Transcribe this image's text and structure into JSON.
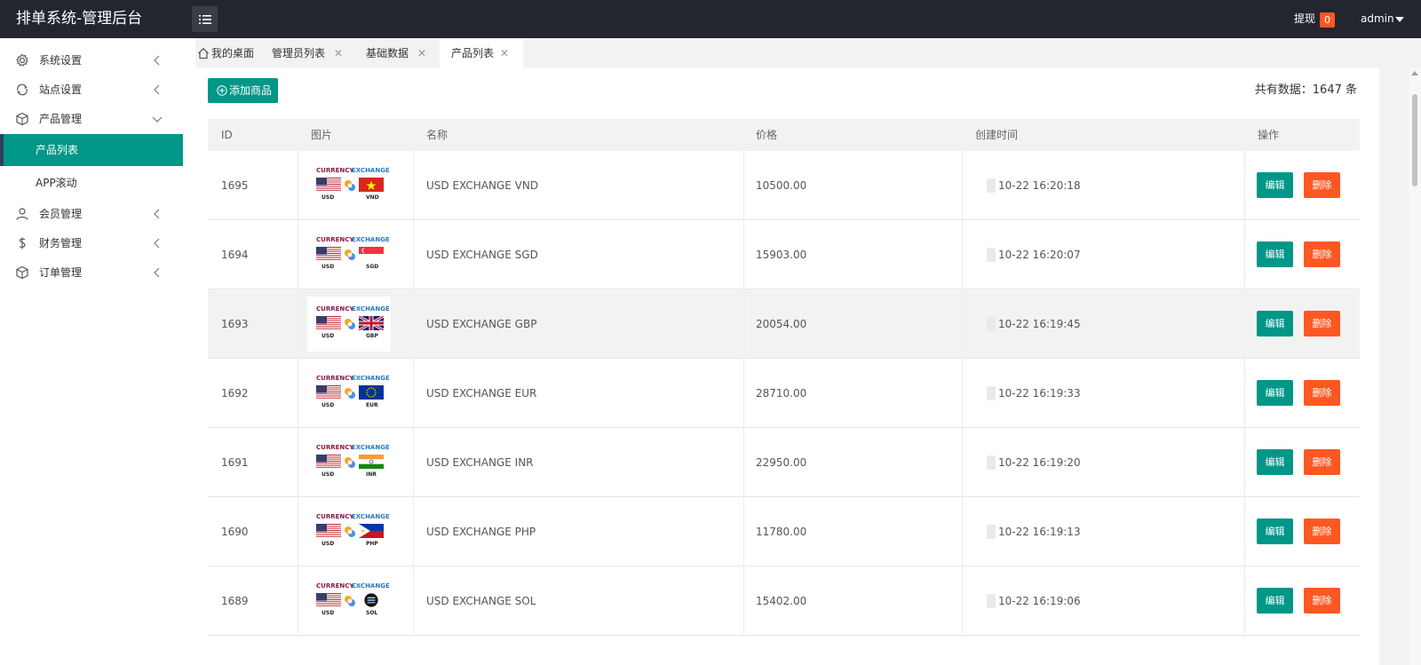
{
  "header": {
    "title": "排单系统-管理后台",
    "withdraw_label": "提现",
    "withdraw_count": "0",
    "user": "admin"
  },
  "sidebar": {
    "items": [
      {
        "label": "系统设置",
        "icon": "gear-icon"
      },
      {
        "label": "站点设置",
        "icon": "refresh-icon"
      },
      {
        "label": "产品管理",
        "icon": "box-icon"
      },
      {
        "label": "会员管理",
        "icon": "user-icon"
      },
      {
        "label": "财务管理",
        "icon": "dollar-icon"
      },
      {
        "label": "订单管理",
        "icon": "box-icon"
      }
    ],
    "sub_items": [
      {
        "label": "产品列表",
        "active": true
      },
      {
        "label": "APP滚动",
        "active": false
      }
    ]
  },
  "tabs": [
    {
      "label": "我的桌面"
    },
    {
      "label": "管理员列表",
      "close": "✕"
    },
    {
      "label": "基础数据",
      "close": "✕"
    },
    {
      "label": "产品列表",
      "close": "✕",
      "active": true
    }
  ],
  "toolbar": {
    "add_label": "添加商品",
    "total_text": "共有数据：1647 条"
  },
  "table": {
    "columns": [
      "ID",
      "图片",
      "名称",
      "价格",
      "创建时间",
      "操作"
    ],
    "image_header": "CURRENCY",
    "image_header2": "EXCHANGE",
    "base_code": "USD",
    "edit_label": "编辑",
    "delete_label": "删除",
    "rows": [
      {
        "id": "1695",
        "name": "USD EXCHANGE VND",
        "price": "10500.00",
        "time": "10-22 16:20:18",
        "code": "VND",
        "flag": "vn"
      },
      {
        "id": "1694",
        "name": "USD EXCHANGE SGD",
        "price": "15903.00",
        "time": "10-22 16:20:07",
        "code": "SGD",
        "flag": "sg"
      },
      {
        "id": "1693",
        "name": "USD EXCHANGE GBP",
        "price": "20054.00",
        "time": "10-22 16:19:45",
        "code": "GBP",
        "flag": "gb"
      },
      {
        "id": "1692",
        "name": "USD EXCHANGE EUR",
        "price": "28710.00",
        "time": "10-22 16:19:33",
        "code": "EUR",
        "flag": "eu"
      },
      {
        "id": "1691",
        "name": "USD EXCHANGE INR",
        "price": "22950.00",
        "time": "10-22 16:19:20",
        "code": "INR",
        "flag": "in"
      },
      {
        "id": "1690",
        "name": "USD EXCHANGE PHP",
        "price": "11780.00",
        "time": "10-22 16:19:13",
        "code": "PHP",
        "flag": "ph"
      },
      {
        "id": "1689",
        "name": "USD EXCHANGE SOL",
        "price": "15402.00",
        "time": "10-22 16:19:06",
        "code": "SOL",
        "flag": "sol"
      }
    ]
  },
  "colors": {
    "primary": "#009688",
    "danger": "#ff5722",
    "header_bg": "#23262e"
  }
}
